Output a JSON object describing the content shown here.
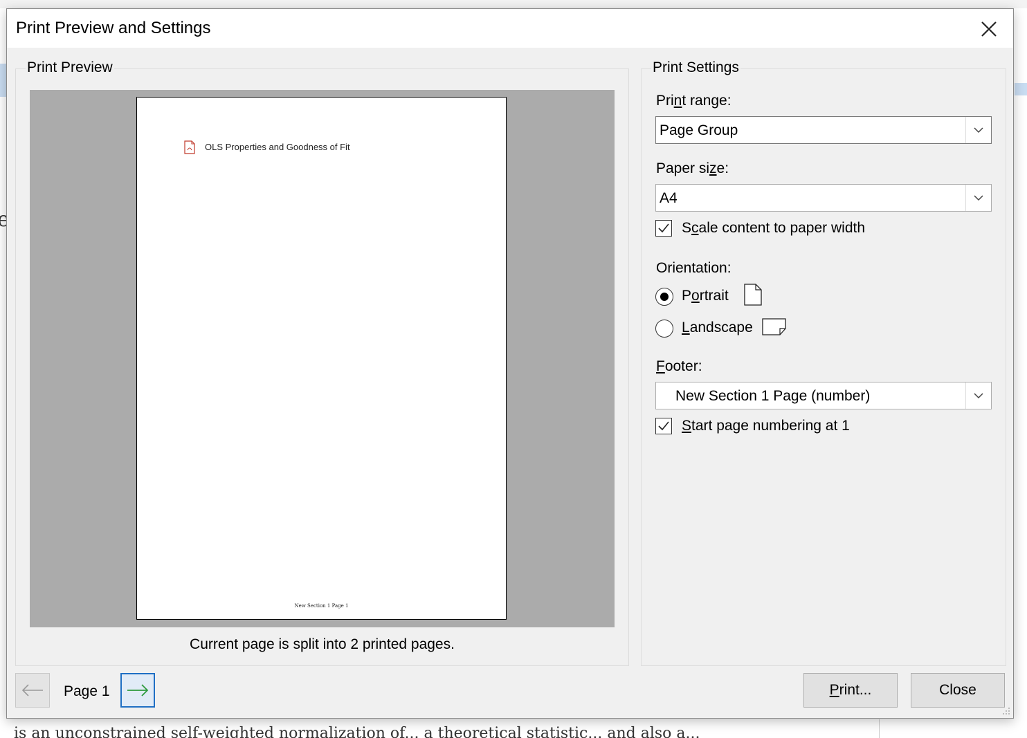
{
  "dialog": {
    "title": "Print Preview and Settings"
  },
  "preview": {
    "group_label": "Print Preview",
    "page_heading": "OLS Properties and Goodness of Fit",
    "page_footer": "New Section 1 Page 1",
    "split_note": "Current page is split into 2 printed pages."
  },
  "settings": {
    "group_label": "Print Settings",
    "print_range": {
      "label_pre": "Pri",
      "label_u": "n",
      "label_post": "t range:",
      "value": "Page Group"
    },
    "paper_size": {
      "label_pre": "Paper si",
      "label_u": "z",
      "label_post": "e:",
      "value": "A4"
    },
    "scale": {
      "label_pre": "S",
      "label_u": "c",
      "label_post": "ale content to paper width",
      "checked": true
    },
    "orientation": {
      "label": "Orientation:",
      "portrait": {
        "label_pre": "P",
        "label_u": "o",
        "label_post": "rtrait",
        "selected": true,
        "icon": "portrait-page-icon"
      },
      "landscape": {
        "label_pre": "",
        "label_u": "L",
        "label_post": "andscape",
        "selected": false,
        "icon": "landscape-page-icon"
      }
    },
    "footer": {
      "label_pre": "",
      "label_u": "F",
      "label_post": "ooter:",
      "value": "New Section 1 Page (number)"
    },
    "start_numbering": {
      "label_pre": "",
      "label_u": "S",
      "label_post": "tart page numbering at 1",
      "checked": true
    }
  },
  "navigation": {
    "page_indicator": "Page 1",
    "prev_icon": "arrow-left-icon",
    "next_icon": "arrow-right-icon"
  },
  "buttons": {
    "print_u": "P",
    "print_rest": "rint...",
    "close": "Close"
  },
  "colors": {
    "dialog_bg": "#f0f0f0",
    "preview_bg": "#ababab",
    "focus_blue": "#1f6fc4",
    "next_arrow": "#2e9a3e"
  },
  "background": {
    "left_glyph": "e",
    "bottom_text": "is an unconstrained self-weighted normalization of... a theoretical statistic... and also a..."
  }
}
